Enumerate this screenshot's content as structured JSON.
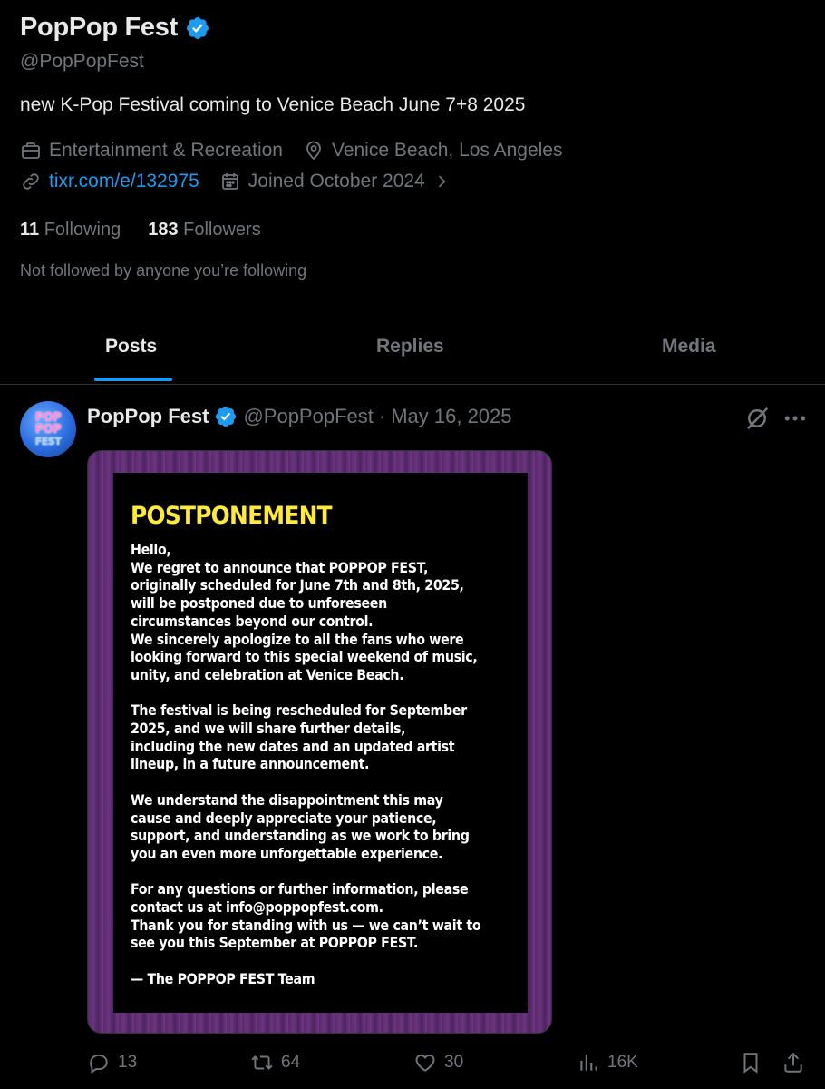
{
  "profile": {
    "display_name": "PopPop Fest",
    "handle": "@PopPopFest",
    "bio": "new K-Pop Festival coming to Venice Beach June 7+8 2025",
    "category": "Entertainment & Recreation",
    "location": "Venice Beach, Los Angeles",
    "website": "tixr.com/e/132975",
    "joined": "Joined October 2024",
    "following_count": "11",
    "following_label": "Following",
    "followers_count": "183",
    "followers_label": "Followers",
    "not_followed": "Not followed by anyone you’re following"
  },
  "tabs": [
    {
      "label": "Posts",
      "active": true
    },
    {
      "label": "Replies",
      "active": false
    },
    {
      "label": "Media",
      "active": false
    }
  ],
  "post": {
    "author_name": "PopPop Fest",
    "author_handle": "@PopPopFest",
    "separator": "·",
    "date": "May 16, 2025",
    "avatar_text": [
      "POP",
      "POP",
      "FEST"
    ],
    "media": {
      "title": "POSTPONEMENT",
      "body": "Hello,\nWe regret to announce that POPPOP FEST,\noriginally scheduled for June 7th and 8th, 2025,\nwill be postponed due to unforeseen\ncircumstances beyond our control.\nWe sincerely apologize to all the fans who were\nlooking forward to this special weekend of music,\nunity, and celebration at Venice Beach.\n\nThe festival is being rescheduled for September\n2025, and we will share further details,\nincluding the new dates and an updated artist\nlineup, in a future announcement.\n\nWe understand the disappointment this may\ncause and deeply appreciate your patience,\nsupport, and understanding as we work to bring\nyou an even more unforgettable experience.\n\nFor any questions or further information, please\ncontact us at info@poppopfest.com.\nThank you for standing with us — we can’t wait to\nsee you this September at POPPOP FEST.\n\n— The POPPOP FEST Team"
    },
    "stats": {
      "replies": "13",
      "reposts": "64",
      "likes": "30",
      "views": "16K"
    }
  },
  "colors": {
    "background": "#000000",
    "text_primary": "#e7e9ea",
    "text_secondary": "#71767b",
    "accent": "#1d9bf0",
    "notice_title": "#ffea3a"
  },
  "icons": [
    "verified-badge-icon",
    "briefcase-icon",
    "location-pin-icon",
    "link-icon",
    "calendar-icon",
    "chevron-right-icon",
    "grok-icon",
    "more-icon",
    "reply-icon",
    "repost-icon",
    "like-icon",
    "views-icon",
    "bookmark-icon",
    "share-icon"
  ]
}
